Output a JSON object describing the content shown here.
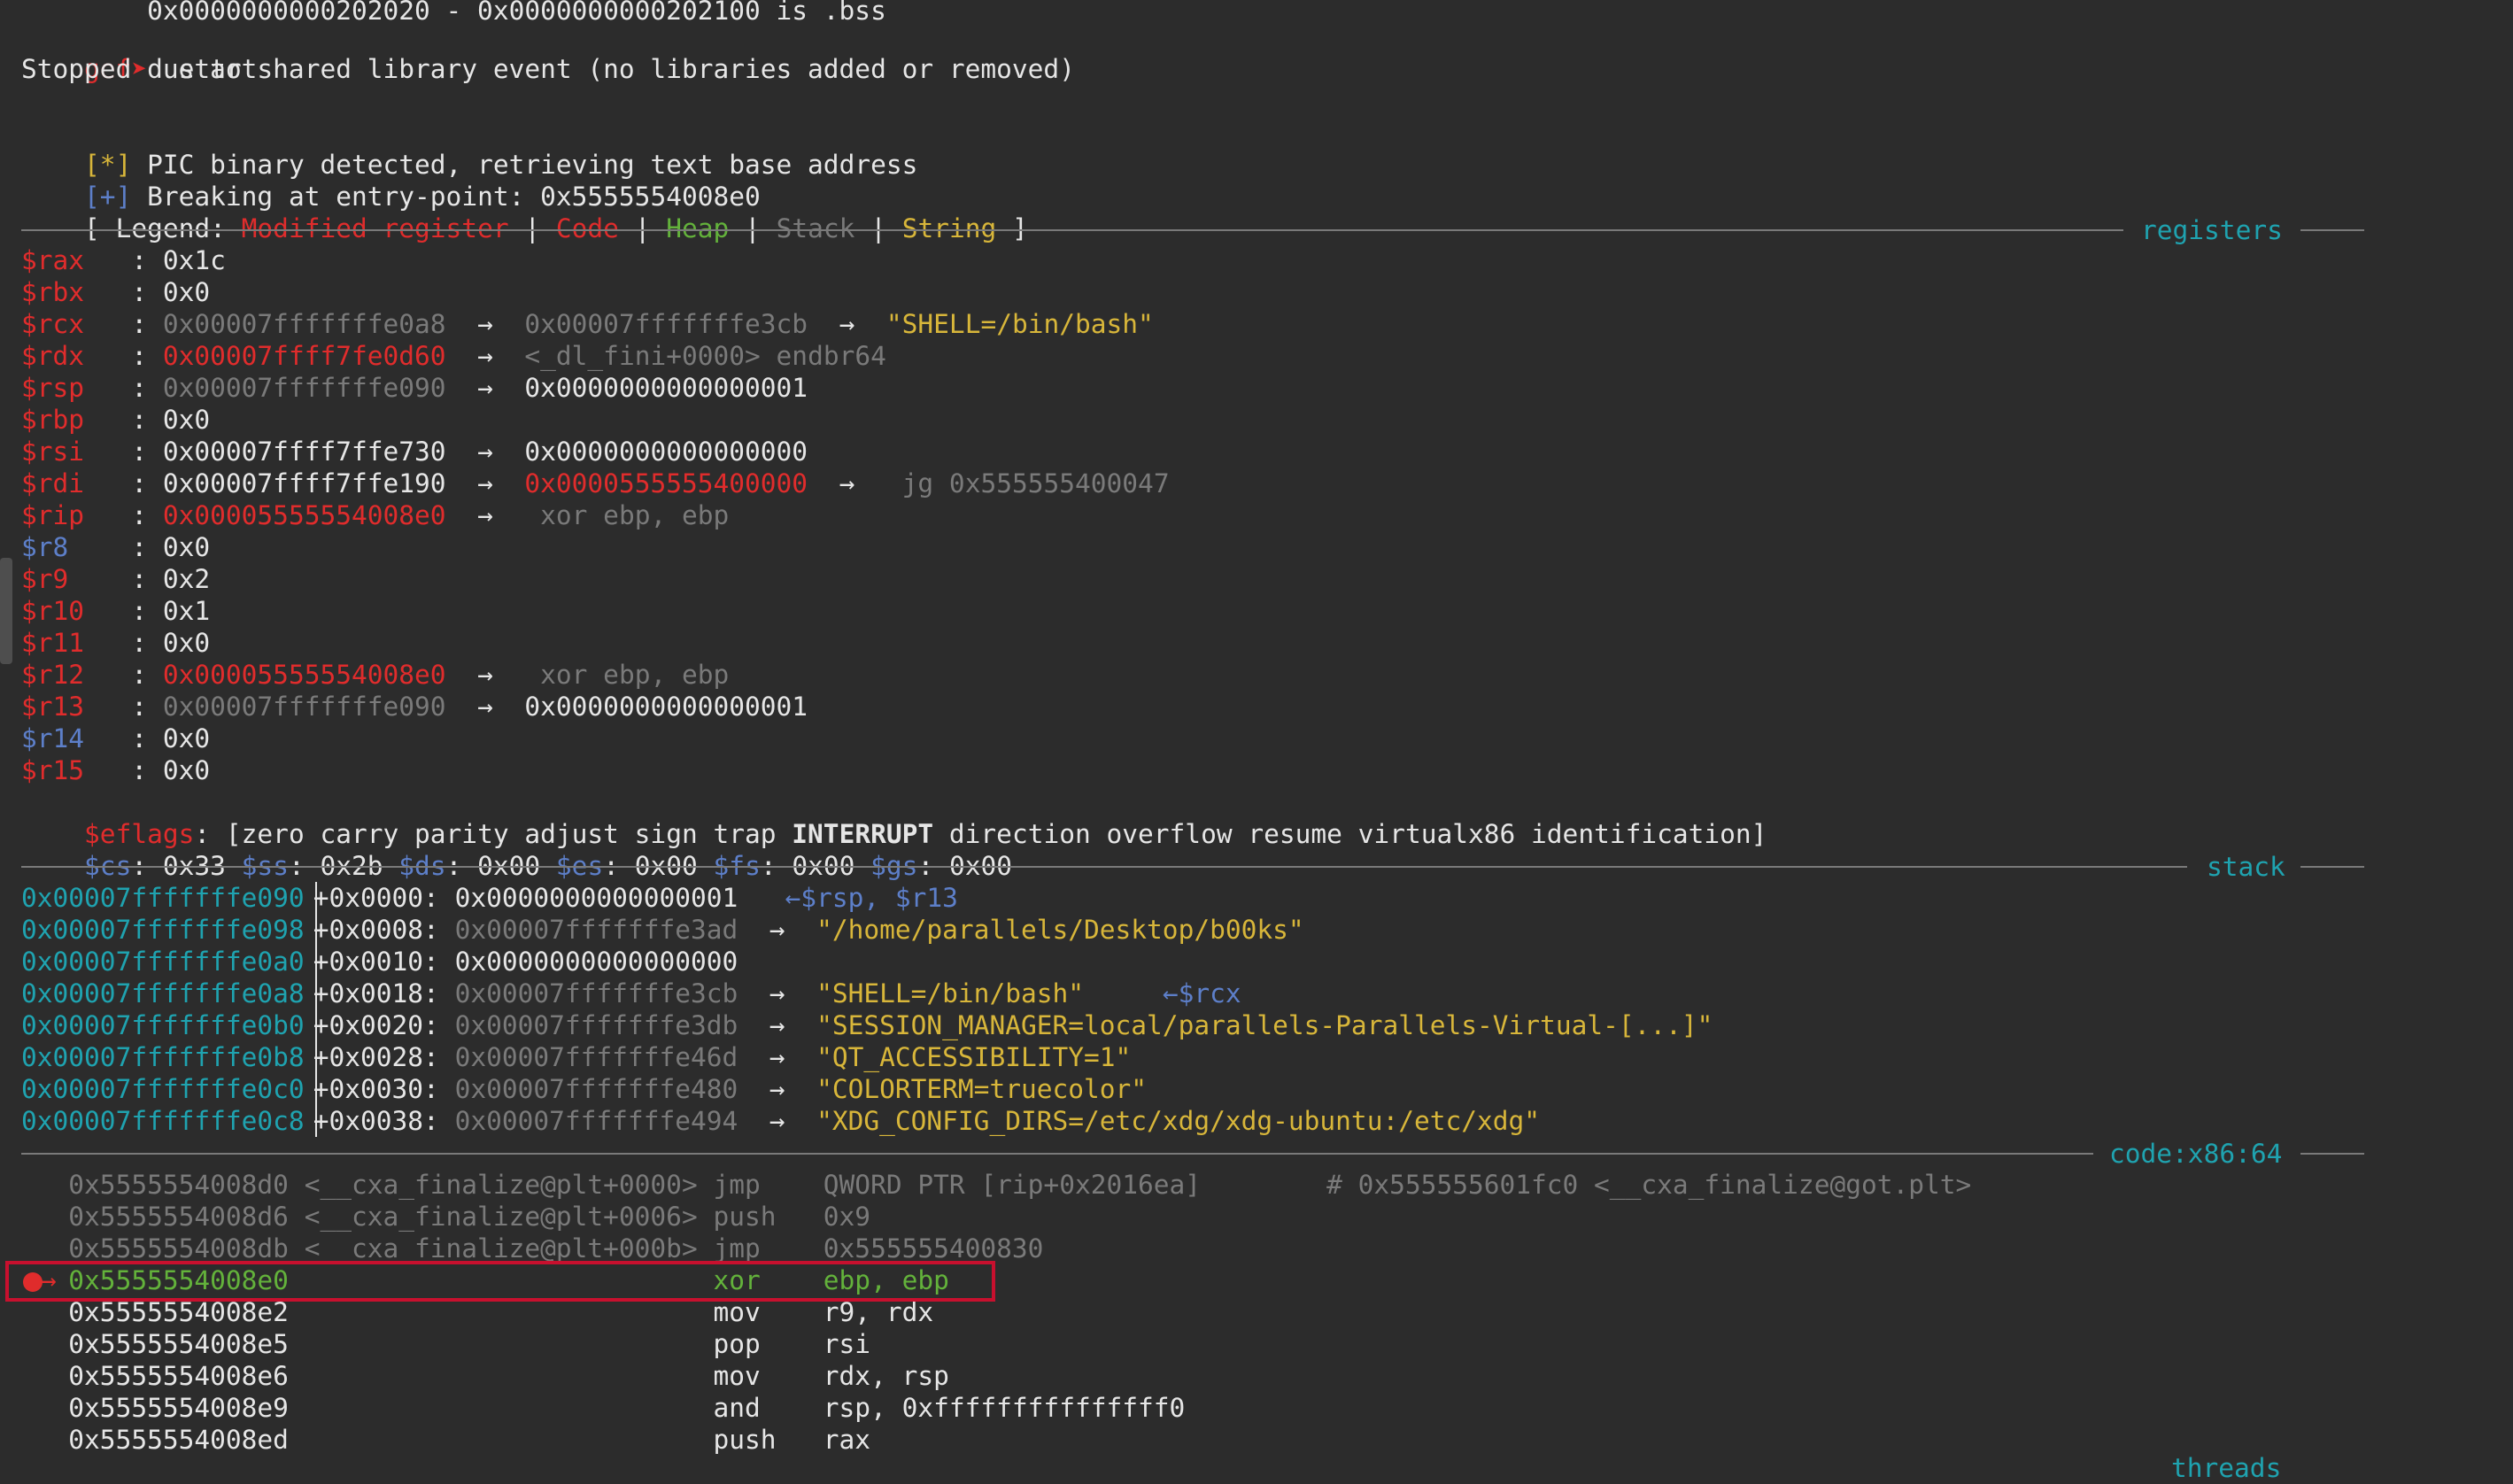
{
  "top": {
    "bss_line": "        0x0000000000202020 - 0x0000000000202100 is .bss",
    "prompt": "gef➤",
    "command": "  start",
    "stopped": "Stopped due to shared library event (no libraries added or removed)",
    "pic_tag": "[*]",
    "pic_text": " PIC binary detected, retrieving text base address",
    "break_tag": "[+]",
    "break_text": " Breaking at entry-point: 0x5555554008e0"
  },
  "legend": {
    "open": "[ Legend: ",
    "modified": "Modified register",
    "bar1": " | ",
    "code": "Code",
    "bar2": " | ",
    "heap": "Heap",
    "bar3": " | ",
    "stack": "Stack",
    "bar4": " | ",
    "string": "String",
    "close": " ]"
  },
  "sections": {
    "registers": "registers",
    "stack": "stack",
    "code": "code:x86:64",
    "threads": "threads"
  },
  "registers": [
    {
      "name": "$rax   ",
      "sep": ": ",
      "val": "0x1c",
      "rest": ""
    },
    {
      "name": "$rbx   ",
      "sep": ": ",
      "val": "0x0",
      "rest": ""
    },
    {
      "name": "$rcx   ",
      "sep": ": ",
      "val": "0x00007fffffffe0a8",
      "arrow": "  →  ",
      "val2": "0x00007fffffffe3cb",
      "arrow2": "  →  ",
      "str": "\"SHELL=/bin/bash\""
    },
    {
      "name": "$rdx   ",
      "sep": ": ",
      "val": "0x00007ffff7fe0d60",
      "arrow": "  →  ",
      "val2": "<_dl_fini+0000> endbr64"
    },
    {
      "name": "$rsp   ",
      "sep": ": ",
      "val": "0x00007fffffffe090",
      "arrow": "  →  ",
      "val2": "0x0000000000000001"
    },
    {
      "name": "$rbp   ",
      "sep": ": ",
      "val": "0x0",
      "rest": ""
    },
    {
      "name": "$rsi   ",
      "sep": ": ",
      "val": "0x00007ffff7ffe730",
      "arrow": "  →  ",
      "val2": "0x0000000000000000"
    },
    {
      "name": "$rdi   ",
      "sep": ": ",
      "val": "0x00007ffff7ffe190",
      "arrow": "  →  ",
      "val2": "0x0000555555400000",
      "arrow2": "  →  ",
      "str": " jg 0x555555400047"
    },
    {
      "name": "$rip   ",
      "sep": ": ",
      "val": "0x00005555554008e0",
      "arrow": "  →  ",
      "val2": " xor ebp, ebp"
    },
    {
      "name": "$r8    ",
      "sep": ": ",
      "val": "0x0"
    },
    {
      "name": "$r9    ",
      "sep": ": ",
      "val": "0x2"
    },
    {
      "name": "$r10   ",
      "sep": ": ",
      "val": "0x1"
    },
    {
      "name": "$r11   ",
      "sep": ": ",
      "val": "0x0"
    },
    {
      "name": "$r12   ",
      "sep": ": ",
      "val": "0x00005555554008e0",
      "arrow": "  →  ",
      "val2": " xor ebp, ebp"
    },
    {
      "name": "$r13   ",
      "sep": ": ",
      "val": "0x00007fffffffe090",
      "arrow": "  →  ",
      "val2": "0x0000000000000001"
    },
    {
      "name": "$r14   ",
      "sep": ": ",
      "val": "0x0"
    },
    {
      "name": "$r15   ",
      "sep": ": ",
      "val": "0x0"
    }
  ],
  "eflags": {
    "name": "$eflags",
    "pre": ": [zero carry parity adjust sign trap ",
    "interrupt": "INTERRUPT",
    "post": " direction overflow resume virtualx86 identification]"
  },
  "segs": {
    "cs": "$cs",
    "cs_v": ": 0x33 ",
    "ss": "$ss",
    "ss_v": ": 0x2b ",
    "ds": "$ds",
    "ds_v": ": 0x00 ",
    "es": "$es",
    "es_v": ": 0x00 ",
    "fs": "$fs",
    "fs_v": ": 0x00 ",
    "gs": "$gs",
    "gs_v": ": 0x00"
  },
  "stack": [
    {
      "addr": "0x00007fffffffe090",
      "off": "+0x0000: ",
      "val": "0x0000000000000001",
      "tag": "   ←$rsp, $r13"
    },
    {
      "addr": "0x00007fffffffe098",
      "off": "+0x0008: ",
      "val": "0x00007fffffffe3ad",
      "arrow": "  →  ",
      "str": "\"/home/parallels/Desktop/b00ks\""
    },
    {
      "addr": "0x00007fffffffe0a0",
      "off": "+0x0010: ",
      "val": "0x0000000000000000"
    },
    {
      "addr": "0x00007fffffffe0a8",
      "off": "+0x0018: ",
      "val": "0x00007fffffffe3cb",
      "arrow": "  →  ",
      "str": "\"SHELL=/bin/bash\"",
      "tag": "     ←$rcx"
    },
    {
      "addr": "0x00007fffffffe0b0",
      "off": "+0x0020: ",
      "val": "0x00007fffffffe3db",
      "arrow": "  →  ",
      "str": "\"SESSION_MANAGER=local/parallels-Parallels-Virtual-[...]\""
    },
    {
      "addr": "0x00007fffffffe0b8",
      "off": "+0x0028: ",
      "val": "0x00007fffffffe46d",
      "arrow": "  →  ",
      "str": "\"QT_ACCESSIBILITY=1\""
    },
    {
      "addr": "0x00007fffffffe0c0",
      "off": "+0x0030: ",
      "val": "0x00007fffffffe480",
      "arrow": "  →  ",
      "str": "\"COLORTERM=truecolor\""
    },
    {
      "addr": "0x00007fffffffe0c8",
      "off": "+0x0038: ",
      "val": "0x00007fffffffe494",
      "arrow": "  →  ",
      "str": "\"XDG_CONFIG_DIRS=/etc/xdg/xdg-ubuntu:/etc/xdg\""
    }
  ],
  "code": [
    {
      "text": "   0x5555554008d0 <__cxa_finalize@plt+0000> jmp    QWORD PTR [rip+0x2016ea]        # 0x555555601fc0 <__cxa_finalize@got.plt>"
    },
    {
      "text": "   0x5555554008d6 <__cxa_finalize@plt+0006> push   0x9"
    },
    {
      "text": "   0x5555554008db <__cxa_finalize@plt+000b> jmp    0x555555400830"
    },
    {
      "text": "   0x5555554008e0                           xor    ebp, ebp"
    },
    {
      "text": "   0x5555554008e2                           mov    r9, rdx"
    },
    {
      "text": "   0x5555554008e5                           pop    rsi"
    },
    {
      "text": "   0x5555554008e6                           mov    rdx, rsp"
    },
    {
      "text": "   0x5555554008e9                           and    rsp, 0xfffffffffffffff0"
    },
    {
      "text": "   0x5555554008ed                           push   rax"
    }
  ],
  "current_arrow": "→"
}
